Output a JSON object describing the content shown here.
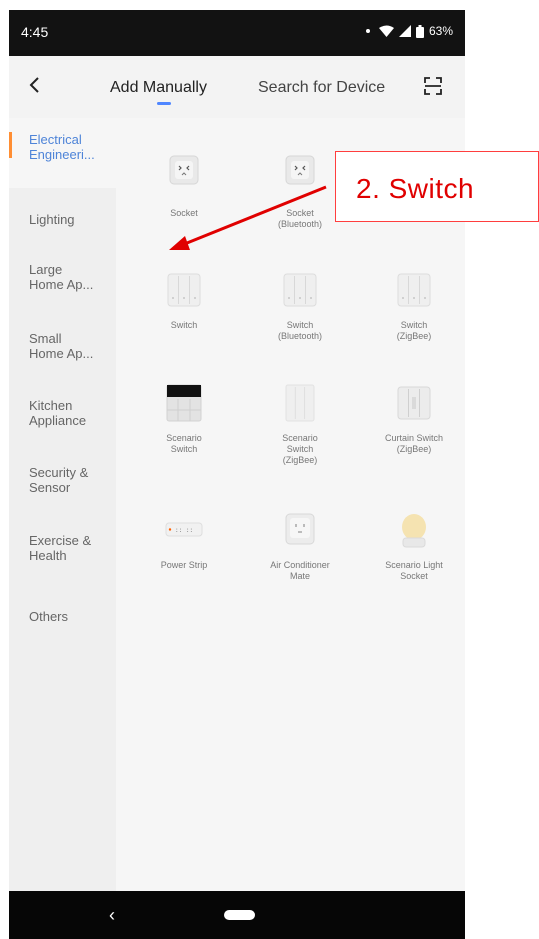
{
  "status_bar": {
    "time": "4:45",
    "battery": "63%"
  },
  "header": {
    "tab_manual": "Add Manually",
    "tab_search": "Search for Device"
  },
  "sidebar": {
    "items": [
      {
        "label": "Electrical\nEngineeri..."
      },
      {
        "label": "Lighting"
      },
      {
        "label": "Large\nHome Ap..."
      },
      {
        "label": "Small\nHome Ap..."
      },
      {
        "label": "Kitchen\nAppliance"
      },
      {
        "label": "Security &\nSensor"
      },
      {
        "label": "Exercise &\nHealth"
      },
      {
        "label": "Others"
      }
    ]
  },
  "devices": [
    {
      "label": "Socket",
      "icon": "socket-icon"
    },
    {
      "label": "Socket\n(Bluetooth)",
      "icon": "socket-bluetooth-icon"
    },
    {
      "label": "Switch",
      "icon": "switch-icon"
    },
    {
      "label": "Switch\n(Bluetooth)",
      "icon": "switch-bluetooth-icon"
    },
    {
      "label": "Switch\n(ZigBee)",
      "icon": "switch-zigbee-icon"
    },
    {
      "label": "Scenario\nSwitch",
      "icon": "scenario-switch-icon"
    },
    {
      "label": "Scenario\nSwitch\n(ZigBee)",
      "icon": "scenario-switch-zigbee-icon"
    },
    {
      "label": "Curtain Switch\n(ZigBee)",
      "icon": "curtain-switch-icon"
    },
    {
      "label": "Power Strip",
      "icon": "power-strip-icon"
    },
    {
      "label": "Air Conditioner\nMate",
      "icon": "air-conditioner-icon"
    },
    {
      "label": "Scenario Light\nSocket",
      "icon": "light-socket-icon"
    }
  ],
  "annotation": {
    "text": "2. Switch",
    "color": "#e00000"
  }
}
